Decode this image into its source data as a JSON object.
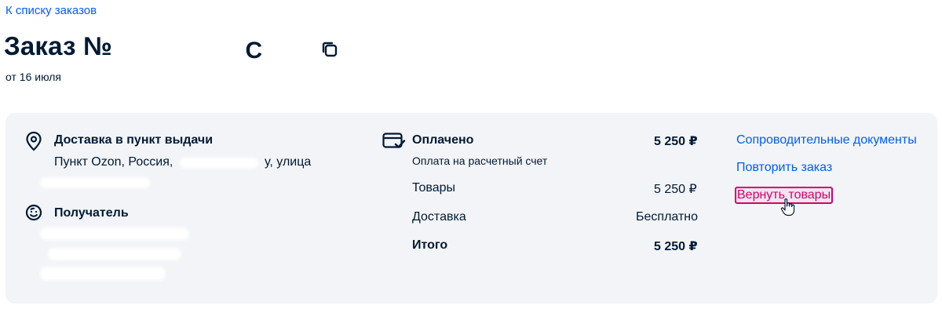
{
  "nav": {
    "back_label": "К списку заказов"
  },
  "order": {
    "title_prefix": "Заказ №",
    "number_visible_tail": "С",
    "date": "от 16 июля"
  },
  "delivery": {
    "title": "Доставка в пункт выдачи",
    "address_line_start": "Пункт Ozon, Россия,",
    "address_line_end": "у, улица"
  },
  "recipient": {
    "title": "Получатель"
  },
  "payment": {
    "status": "Оплачено",
    "status_amount": "5 250 ₽",
    "method": "Оплата на расчетный счет",
    "rows": [
      {
        "label": "Товары",
        "value": "5 250 ₽"
      },
      {
        "label": "Доставка",
        "value": "Бесплатно"
      },
      {
        "label": "Итого",
        "value": "5 250 ₽"
      }
    ]
  },
  "actions": {
    "documents": "Сопроводительные документы",
    "repeat": "Повторить заказ",
    "return": "Вернуть товары"
  },
  "colors": {
    "accent": "#005bff",
    "return_link": "#d6006d",
    "text": "#001a34",
    "card_bg": "#f2f4f7"
  }
}
